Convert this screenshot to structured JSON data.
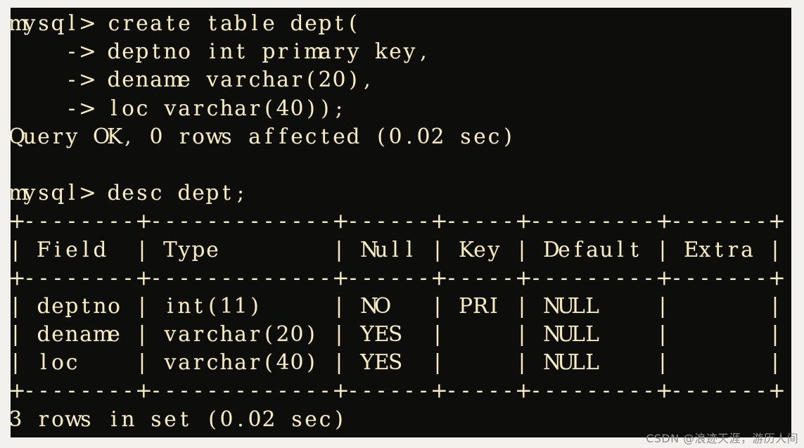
{
  "terminal": {
    "background_color": "#0d0d0c",
    "text_color": "#f7ecc0",
    "page_background_color": "#f2f1ed",
    "prompt": "mysql>",
    "continuation_prompt": "->",
    "lines": [
      "mysql> create table dept(",
      "    -> deptno int primary key,",
      "    -> dename varchar(20),",
      "    -> loc varchar(40));",
      "Query OK, 0 rows affected (0.02 sec)",
      "",
      "mysql> desc dept;",
      "+--------+-------------+------+-----+---------+-------+",
      "| Field  | Type        | Null | Key | Default | Extra |",
      "+--------+-------------+------+-----+---------+-------+",
      "| deptno | int(11)     | NO   | PRI | NULL    |       |",
      "| dename | varchar(20) | YES  |     | NULL    |       |",
      "| loc    | varchar(40) | YES  |     | NULL    |       |",
      "+--------+-------------+------+-----+---------+-------+",
      "3 rows in set (0.02 sec)"
    ],
    "statements": [
      {
        "command": "create table dept(",
        "continuation": [
          "deptno int primary key,",
          "dename varchar(20),",
          "loc varchar(40));"
        ],
        "result": "Query OK, 0 rows affected (0.02 sec)"
      },
      {
        "command": "desc dept;",
        "result": "3 rows in set (0.02 sec)"
      }
    ],
    "result_table": {
      "columns": [
        "Field",
        "Type",
        "Null",
        "Key",
        "Default",
        "Extra"
      ],
      "rows": [
        [
          "deptno",
          "int(11)",
          "NO",
          "PRI",
          "NULL",
          ""
        ],
        [
          "dename",
          "varchar(20)",
          "YES",
          "",
          "NULL",
          ""
        ],
        [
          "loc",
          "varchar(40)",
          "YES",
          "",
          "NULL",
          ""
        ]
      ],
      "row_count_text": "3 rows in set (0.02 sec)"
    }
  },
  "watermark": {
    "text": "CSDN @浪迹天涯，游历人间",
    "color": "#8d8d8d"
  }
}
